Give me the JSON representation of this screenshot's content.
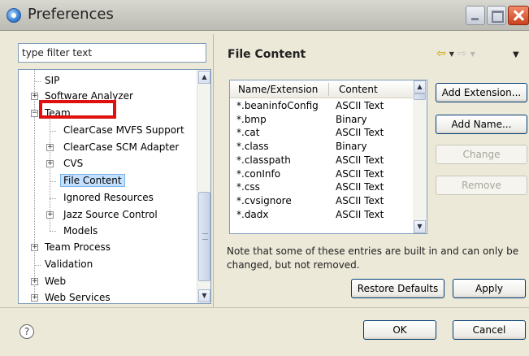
{
  "window": {
    "title": "Preferences"
  },
  "filter": {
    "placeholder": "type filter text",
    "value": "type filter text"
  },
  "tree": {
    "items": [
      {
        "label": "SIP"
      },
      {
        "label": "Software Analyzer"
      },
      {
        "label": "Team"
      },
      {
        "label": "ClearCase MVFS Support"
      },
      {
        "label": "ClearCase SCM Adapter"
      },
      {
        "label": "CVS"
      },
      {
        "label": "File Content"
      },
      {
        "label": "Ignored Resources"
      },
      {
        "label": "Jazz Source Control"
      },
      {
        "label": "Models"
      },
      {
        "label": "Team Process"
      },
      {
        "label": "Validation"
      },
      {
        "label": "Web"
      },
      {
        "label": "Web Services"
      }
    ]
  },
  "page": {
    "title": "File Content"
  },
  "table": {
    "columns": [
      "Name/Extension",
      "Content"
    ],
    "rows": [
      [
        "*.beaninfoConfig",
        "ASCII Text"
      ],
      [
        "*.bmp",
        "Binary"
      ],
      [
        "*.cat",
        "ASCII Text"
      ],
      [
        "*.class",
        "Binary"
      ],
      [
        "*.classpath",
        "ASCII Text"
      ],
      [
        "*.conInfo",
        "ASCII Text"
      ],
      [
        "*.css",
        "ASCII Text"
      ],
      [
        "*.cvsignore",
        "ASCII Text"
      ],
      [
        "*.dadx",
        "ASCII Text"
      ]
    ]
  },
  "buttons": {
    "add_extension": "Add Extension...",
    "add_name": "Add Name...",
    "change": "Change",
    "remove": "Remove",
    "restore_defaults": "Restore Defaults",
    "apply": "Apply",
    "ok": "OK",
    "cancel": "Cancel"
  },
  "note": "Note that some of these entries are built in and can only be changed, but not removed.",
  "help": "?",
  "colors": {
    "selection_outline": "#e01010",
    "title_bar": "#c9c8c1"
  }
}
